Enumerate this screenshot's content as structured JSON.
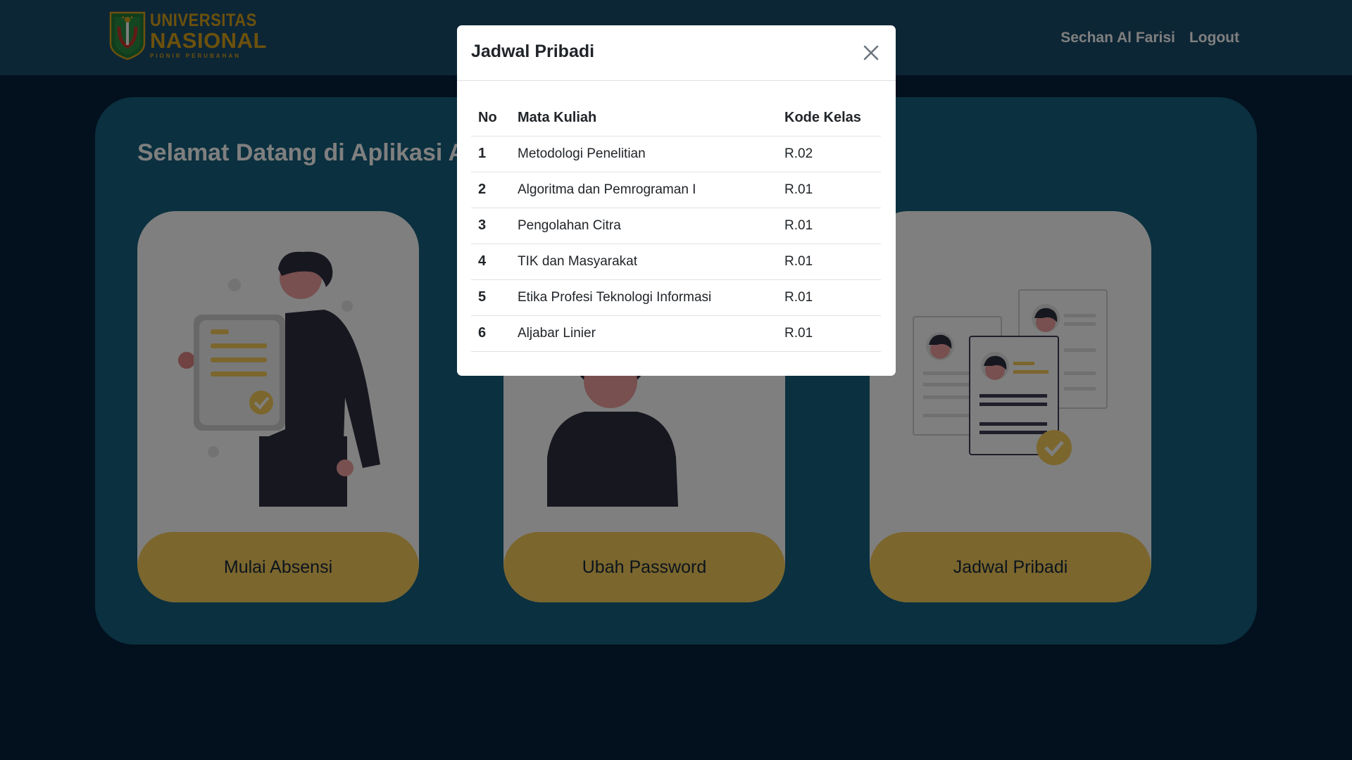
{
  "navbar": {
    "logo": {
      "line1": "UNIVERSITAS",
      "line2": "NASIONAL",
      "line3": "PIONIR PERUBAHAN"
    },
    "user_name": "Sechan Al Farisi",
    "logout_label": "Logout"
  },
  "main": {
    "welcome_text": "Selamat Datang di Aplikasi Absensi",
    "cards": [
      {
        "label": "Mulai Absensi",
        "icon": "certificate-person-illustration"
      },
      {
        "label": "Ubah Password",
        "icon": "person-avatar-illustration"
      },
      {
        "label": "Jadwal Pribadi",
        "icon": "documents-illustration"
      }
    ]
  },
  "modal": {
    "title": "Jadwal Pribadi",
    "close_icon": "close-icon",
    "table": {
      "headers": [
        "No",
        "Mata Kuliah",
        "Kode Kelas"
      ],
      "rows": [
        [
          "1",
          "Metodologi Penelitian",
          "R.02"
        ],
        [
          "2",
          "Algoritma dan Pemrograman I",
          "R.01"
        ],
        [
          "3",
          "Pengolahan Citra",
          "R.01"
        ],
        [
          "4",
          "TIK dan Masyarakat",
          "R.01"
        ],
        [
          "5",
          "Etika Profesi Teknologi Informasi",
          "R.01"
        ],
        [
          "6",
          "Aljabar Linier",
          "R.01"
        ]
      ]
    }
  },
  "colors": {
    "navbar": "#1a4c6b",
    "page_bg": "#06213a",
    "panel": "#17607f",
    "card_button": "#f6cd5a",
    "logo_accent": "#d9a21b"
  }
}
